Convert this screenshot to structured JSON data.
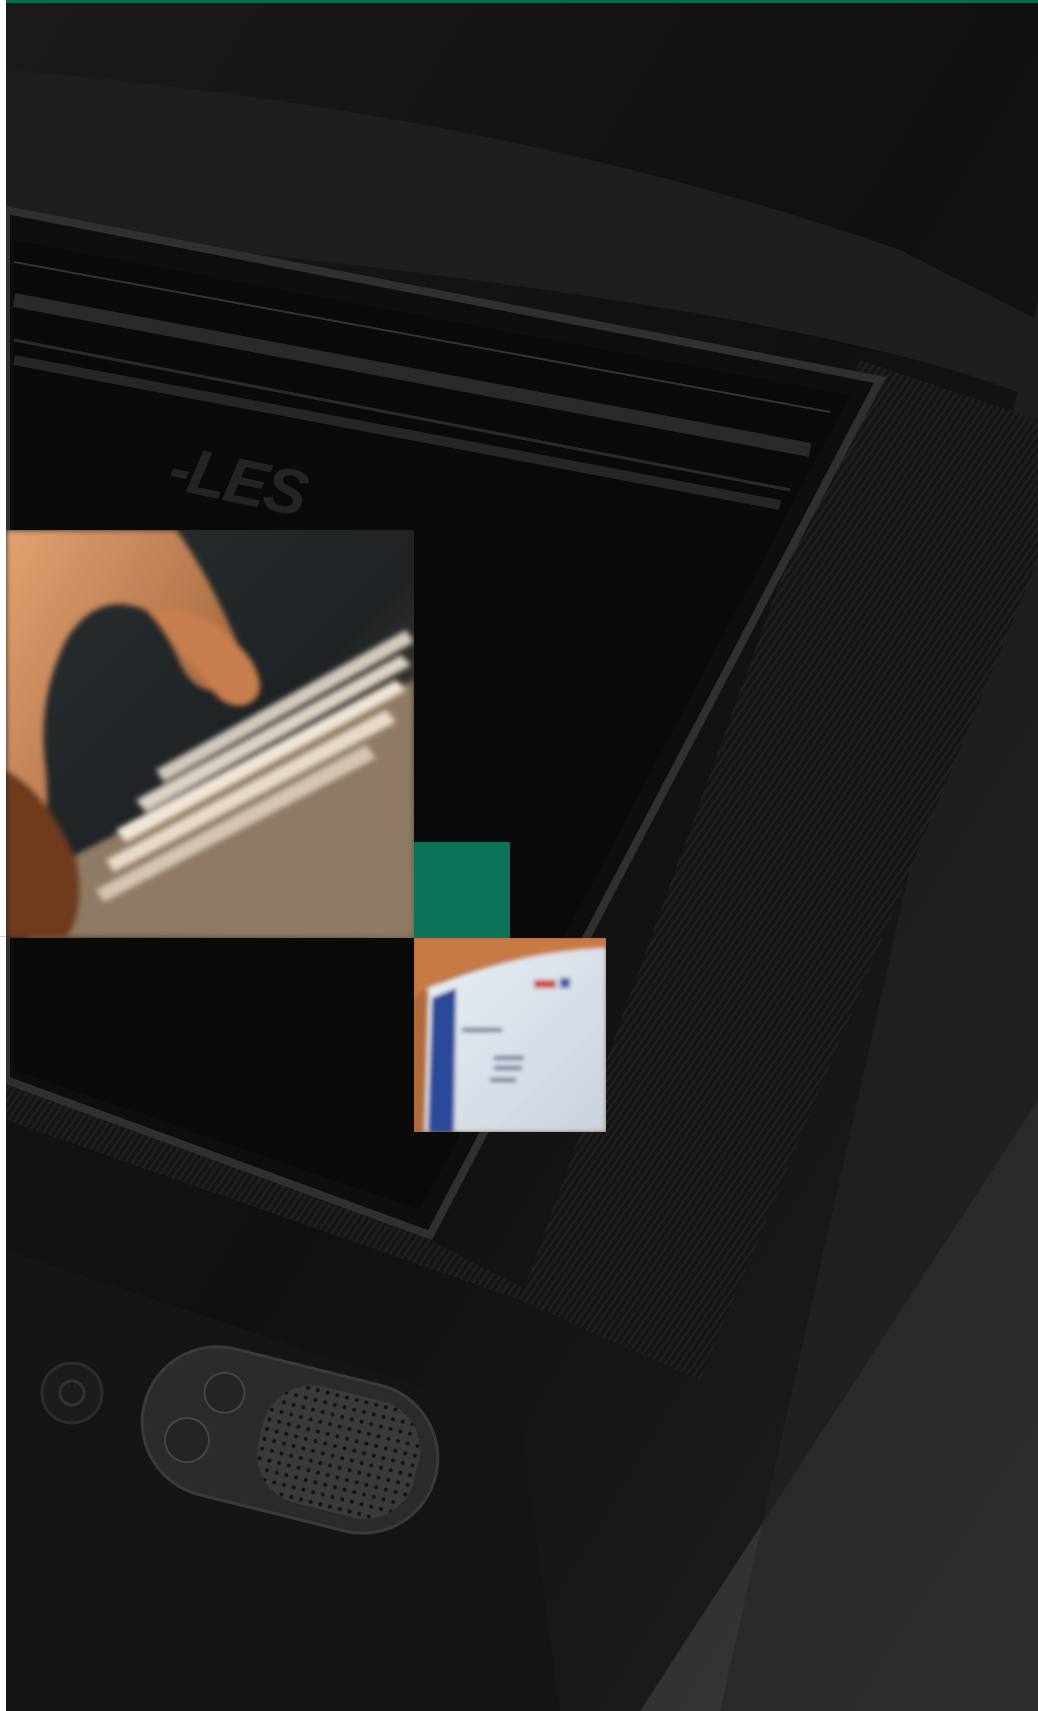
{
  "screen_logo": "-LES",
  "colors": {
    "accent_green": "#0b7358",
    "top_rule": "#0b6b4f",
    "background": "#0b0b0b"
  },
  "photos": {
    "keyboard": "hand-typing-on-keyboard",
    "browser": "computer-screen-with-webpage"
  }
}
